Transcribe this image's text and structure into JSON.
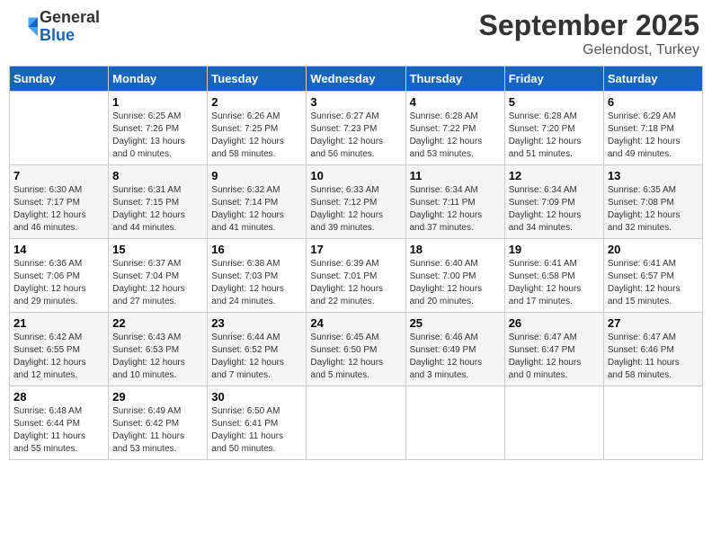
{
  "header": {
    "logo_line1": "General",
    "logo_line2": "Blue",
    "month_title": "September 2025",
    "subtitle": "Gelendost, Turkey"
  },
  "days_of_week": [
    "Sunday",
    "Monday",
    "Tuesday",
    "Wednesday",
    "Thursday",
    "Friday",
    "Saturday"
  ],
  "weeks": [
    [
      {
        "day": "",
        "info": ""
      },
      {
        "day": "1",
        "info": "Sunrise: 6:25 AM\nSunset: 7:26 PM\nDaylight: 13 hours\nand 0 minutes."
      },
      {
        "day": "2",
        "info": "Sunrise: 6:26 AM\nSunset: 7:25 PM\nDaylight: 12 hours\nand 58 minutes."
      },
      {
        "day": "3",
        "info": "Sunrise: 6:27 AM\nSunset: 7:23 PM\nDaylight: 12 hours\nand 56 minutes."
      },
      {
        "day": "4",
        "info": "Sunrise: 6:28 AM\nSunset: 7:22 PM\nDaylight: 12 hours\nand 53 minutes."
      },
      {
        "day": "5",
        "info": "Sunrise: 6:28 AM\nSunset: 7:20 PM\nDaylight: 12 hours\nand 51 minutes."
      },
      {
        "day": "6",
        "info": "Sunrise: 6:29 AM\nSunset: 7:18 PM\nDaylight: 12 hours\nand 49 minutes."
      }
    ],
    [
      {
        "day": "7",
        "info": "Sunrise: 6:30 AM\nSunset: 7:17 PM\nDaylight: 12 hours\nand 46 minutes."
      },
      {
        "day": "8",
        "info": "Sunrise: 6:31 AM\nSunset: 7:15 PM\nDaylight: 12 hours\nand 44 minutes."
      },
      {
        "day": "9",
        "info": "Sunrise: 6:32 AM\nSunset: 7:14 PM\nDaylight: 12 hours\nand 41 minutes."
      },
      {
        "day": "10",
        "info": "Sunrise: 6:33 AM\nSunset: 7:12 PM\nDaylight: 12 hours\nand 39 minutes."
      },
      {
        "day": "11",
        "info": "Sunrise: 6:34 AM\nSunset: 7:11 PM\nDaylight: 12 hours\nand 37 minutes."
      },
      {
        "day": "12",
        "info": "Sunrise: 6:34 AM\nSunset: 7:09 PM\nDaylight: 12 hours\nand 34 minutes."
      },
      {
        "day": "13",
        "info": "Sunrise: 6:35 AM\nSunset: 7:08 PM\nDaylight: 12 hours\nand 32 minutes."
      }
    ],
    [
      {
        "day": "14",
        "info": "Sunrise: 6:36 AM\nSunset: 7:06 PM\nDaylight: 12 hours\nand 29 minutes."
      },
      {
        "day": "15",
        "info": "Sunrise: 6:37 AM\nSunset: 7:04 PM\nDaylight: 12 hours\nand 27 minutes."
      },
      {
        "day": "16",
        "info": "Sunrise: 6:38 AM\nSunset: 7:03 PM\nDaylight: 12 hours\nand 24 minutes."
      },
      {
        "day": "17",
        "info": "Sunrise: 6:39 AM\nSunset: 7:01 PM\nDaylight: 12 hours\nand 22 minutes."
      },
      {
        "day": "18",
        "info": "Sunrise: 6:40 AM\nSunset: 7:00 PM\nDaylight: 12 hours\nand 20 minutes."
      },
      {
        "day": "19",
        "info": "Sunrise: 6:41 AM\nSunset: 6:58 PM\nDaylight: 12 hours\nand 17 minutes."
      },
      {
        "day": "20",
        "info": "Sunrise: 6:41 AM\nSunset: 6:57 PM\nDaylight: 12 hours\nand 15 minutes."
      }
    ],
    [
      {
        "day": "21",
        "info": "Sunrise: 6:42 AM\nSunset: 6:55 PM\nDaylight: 12 hours\nand 12 minutes."
      },
      {
        "day": "22",
        "info": "Sunrise: 6:43 AM\nSunset: 6:53 PM\nDaylight: 12 hours\nand 10 minutes."
      },
      {
        "day": "23",
        "info": "Sunrise: 6:44 AM\nSunset: 6:52 PM\nDaylight: 12 hours\nand 7 minutes."
      },
      {
        "day": "24",
        "info": "Sunrise: 6:45 AM\nSunset: 6:50 PM\nDaylight: 12 hours\nand 5 minutes."
      },
      {
        "day": "25",
        "info": "Sunrise: 6:46 AM\nSunset: 6:49 PM\nDaylight: 12 hours\nand 3 minutes."
      },
      {
        "day": "26",
        "info": "Sunrise: 6:47 AM\nSunset: 6:47 PM\nDaylight: 12 hours\nand 0 minutes."
      },
      {
        "day": "27",
        "info": "Sunrise: 6:47 AM\nSunset: 6:46 PM\nDaylight: 11 hours\nand 58 minutes."
      }
    ],
    [
      {
        "day": "28",
        "info": "Sunrise: 6:48 AM\nSunset: 6:44 PM\nDaylight: 11 hours\nand 55 minutes."
      },
      {
        "day": "29",
        "info": "Sunrise: 6:49 AM\nSunset: 6:42 PM\nDaylight: 11 hours\nand 53 minutes."
      },
      {
        "day": "30",
        "info": "Sunrise: 6:50 AM\nSunset: 6:41 PM\nDaylight: 11 hours\nand 50 minutes."
      },
      {
        "day": "",
        "info": ""
      },
      {
        "day": "",
        "info": ""
      },
      {
        "day": "",
        "info": ""
      },
      {
        "day": "",
        "info": ""
      }
    ]
  ]
}
